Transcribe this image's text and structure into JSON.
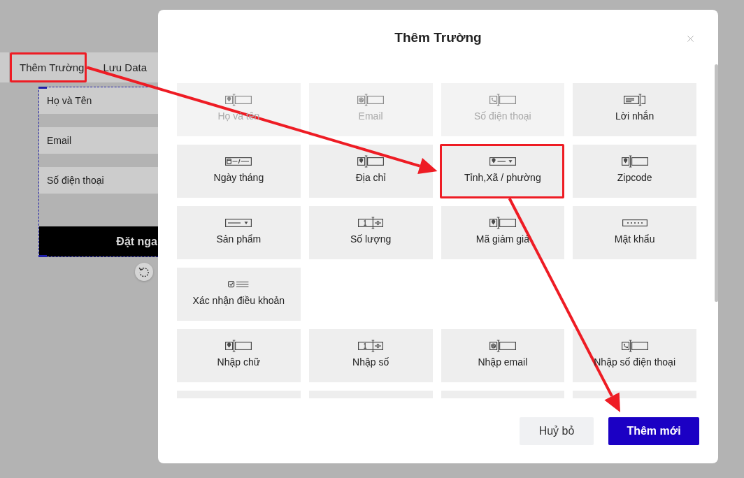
{
  "toolbar": {
    "items": [
      {
        "label": "Thêm Trường",
        "highlighted": true
      },
      {
        "label": "Lưu Data",
        "highlighted": false
      }
    ]
  },
  "form_preview": {
    "fields": [
      {
        "placeholder": "Họ và Tên"
      },
      {
        "placeholder": "Email"
      },
      {
        "placeholder": "Số điện thoại"
      }
    ],
    "submit_button": {
      "label": "Đặt nga"
    }
  },
  "dialog": {
    "title": "Thêm Trường",
    "groups": [
      {
        "items": [
          {
            "label": "Họ và tên",
            "kind": "text",
            "disabled": true,
            "highlighted": false
          },
          {
            "label": "Email",
            "kind": "email",
            "disabled": true,
            "highlighted": false
          },
          {
            "label": "Số điện thoại",
            "kind": "phone",
            "disabled": true,
            "highlighted": false
          },
          {
            "label": "Lời nhắn",
            "kind": "textarea",
            "disabled": false,
            "highlighted": false
          },
          {
            "label": "Ngày tháng",
            "kind": "date",
            "disabled": false,
            "highlighted": false
          },
          {
            "label": "Địa chỉ",
            "kind": "text",
            "disabled": false,
            "highlighted": false
          },
          {
            "label": "Tỉnh,Xã / phường",
            "kind": "location-select",
            "disabled": false,
            "highlighted": true
          },
          {
            "label": "Zipcode",
            "kind": "text",
            "disabled": false,
            "highlighted": false
          },
          {
            "label": "Sản phẩm",
            "kind": "select",
            "disabled": false,
            "highlighted": false
          },
          {
            "label": "Số lượng",
            "kind": "number",
            "disabled": false,
            "highlighted": false
          },
          {
            "label": "Mã giảm giá",
            "kind": "text",
            "disabled": false,
            "highlighted": false
          },
          {
            "label": "Mật khẩu",
            "kind": "password",
            "disabled": false,
            "highlighted": false
          },
          {
            "label": "Xác nhận điều khoản",
            "kind": "checkbox",
            "disabled": false,
            "highlighted": false
          }
        ]
      },
      {
        "items": [
          {
            "label": "Nhập chữ",
            "kind": "text",
            "disabled": false,
            "highlighted": false
          },
          {
            "label": "Nhập số",
            "kind": "number",
            "disabled": false,
            "highlighted": false
          },
          {
            "label": "Nhập email",
            "kind": "email",
            "disabled": false,
            "highlighted": false
          },
          {
            "label": "Nhập số điện thoại",
            "kind": "phone",
            "disabled": false,
            "highlighted": false
          },
          {
            "highlighted": false
          },
          {
            "highlighted": false
          },
          {
            "highlighted": false
          },
          {
            "highlighted": false
          }
        ]
      }
    ],
    "buttons": [
      {
        "label": "Huỷ bỏ",
        "kind": "secondary",
        "arrow_target": false
      },
      {
        "label": "Thêm mới",
        "kind": "primary",
        "arrow_target": true
      }
    ]
  }
}
